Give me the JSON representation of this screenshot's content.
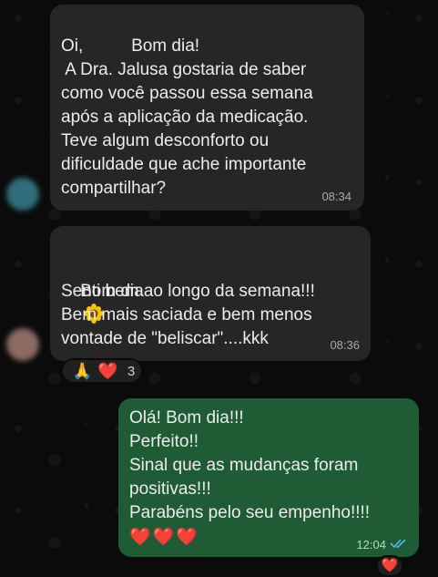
{
  "messages": [
    {
      "id": "m1",
      "lines": [
        "Oi,          Bom dia!",
        " A Dra. Jalusa gostaria de saber",
        "como você passou essa semana",
        "após a aplicação da medicação.",
        "Teve algum desconforto ou",
        "dificuldade que ache importante",
        "compartilhar?"
      ],
      "time": "08:34"
    },
    {
      "id": "m2",
      "first_line": "Bom dia",
      "first_line_icon": "sunflower-icon",
      "lines": [
        "Senti bem ao longo da semana!!!",
        "Bem mais saciada e bem menos",
        "vontade de \"beliscar\"....kkk"
      ],
      "time": "08:36",
      "reactions": {
        "emojis": [
          "🙏",
          "❤️"
        ],
        "count": "3"
      }
    },
    {
      "id": "m3",
      "lines": [
        "Olá! Bom dia!!!",
        "Perfeito!!",
        "Sinal que as mudanças foram",
        "positivas!!!",
        "Parabéns pelo seu empenho!!!!"
      ],
      "emoji_line": "❤️❤️❤️",
      "time": "12:04",
      "status_icon": "double-check-read-icon",
      "reaction_partial": "❤️"
    }
  ],
  "colors": {
    "incoming_bubble": "#262626",
    "outgoing_bubble": "#1f5c36",
    "read_ticks": "#53bdeb"
  }
}
